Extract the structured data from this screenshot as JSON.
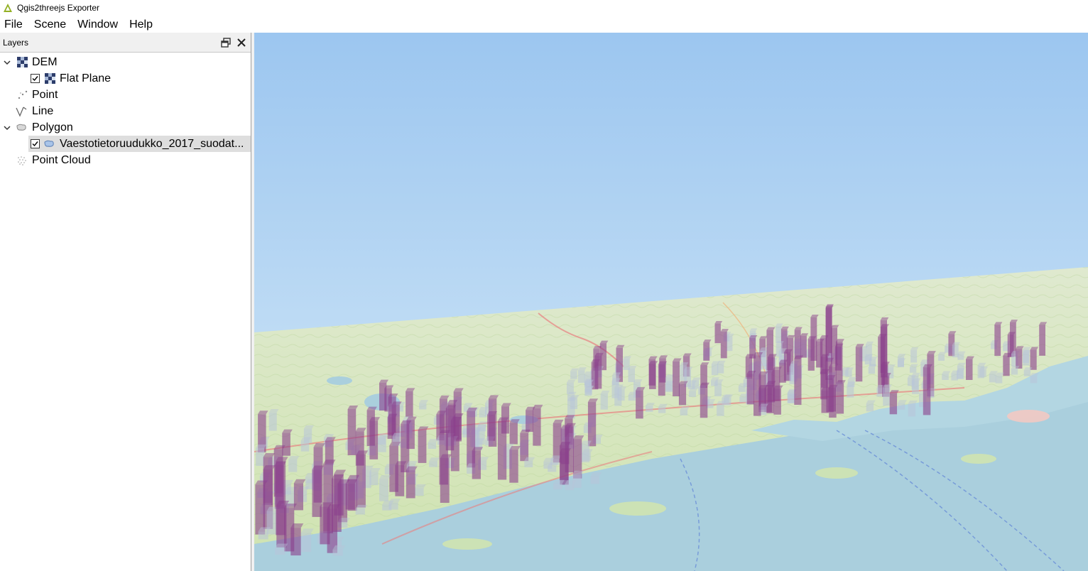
{
  "window": {
    "title": "Qgis2threejs Exporter",
    "icon": "qgis-triangle-icon"
  },
  "menubar": {
    "items": [
      "File",
      "Scene",
      "Window",
      "Help"
    ]
  },
  "layers_panel": {
    "title": "Layers",
    "float_button": "float-dock-icon",
    "close_button": "close-icon",
    "tree": [
      {
        "label": "DEM",
        "expanded": true,
        "icon": "raster-icon"
      },
      {
        "label": "Flat Plane",
        "checked": true,
        "icon": "raster-icon"
      },
      {
        "label": "Point",
        "icon": "point-layer-icon"
      },
      {
        "label": "Line",
        "icon": "line-layer-icon"
      },
      {
        "label": "Polygon",
        "expanded": true,
        "icon": "polygon-layer-icon"
      },
      {
        "label": "Vaestotietoruudukko_2017_suodat...",
        "checked": true,
        "selected": true,
        "icon": "polygon-layer-icon"
      },
      {
        "label": "Point Cloud",
        "icon": "pointcloud-layer-icon"
      }
    ]
  },
  "viewer": {
    "sky_top": "#9cc6f0",
    "sky_bottom": "#d9ecf7",
    "land_color": "#cfe3b0",
    "water_color": "#aacfdd",
    "low_column_color": "#b8c4d8",
    "high_column_color": "#8a3f8c"
  }
}
